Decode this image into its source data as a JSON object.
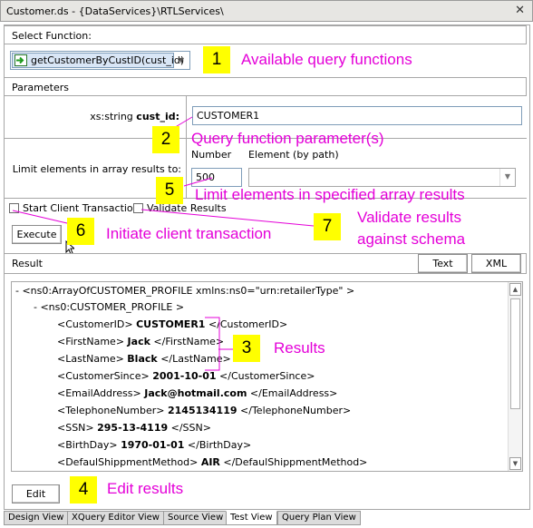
{
  "window": {
    "title": "Customer.ds - {DataServices}\\RTLServices\\"
  },
  "select_function": {
    "header": "Select Function:",
    "selected": "getCustomerByCustID(cust_id)"
  },
  "parameters": {
    "header": "Parameters",
    "param_label_type": "xs:string ",
    "param_label_name": "cust_id:",
    "param_value": "CUSTOMER1",
    "limit_label": "Limit elements in array results to:",
    "number_header": "Number",
    "element_header": "Element (by path)",
    "number_value": "500",
    "element_value": ""
  },
  "options": {
    "start_tx_label": "Start Client Transaction",
    "validate_label": "Validate Results",
    "start_tx_checked": false,
    "validate_checked": false
  },
  "buttons": {
    "execute": "Execute",
    "text": "Text",
    "xml": "XML",
    "edit": "Edit"
  },
  "result": {
    "header": "Result",
    "lines": [
      {
        "pre": "- <ns0:ArrayOfCUSTOMER_PROFILE xmlns:ns0=\"urn:retailerType\" >",
        "val": "",
        "post": ""
      },
      {
        "pre": "- <ns0:CUSTOMER_PROFILE >",
        "val": "",
        "post": ""
      },
      {
        "pre": "<CustomerID> ",
        "val": "CUSTOMER1",
        "post": " </CustomerID>"
      },
      {
        "pre": "<FirstName> ",
        "val": "Jack",
        "post": " </FirstName>"
      },
      {
        "pre": "<LastName> ",
        "val": "Black",
        "post": " </LastName>"
      },
      {
        "pre": "<CustomerSince> ",
        "val": "2001-10-01",
        "post": " </CustomerSince>"
      },
      {
        "pre": "<EmailAddress> ",
        "val": "Jack@hotmail.com",
        "post": " </EmailAddress>"
      },
      {
        "pre": "<TelephoneNumber> ",
        "val": "2145134119",
        "post": " </TelephoneNumber>"
      },
      {
        "pre": "<SSN> ",
        "val": "295-13-4119",
        "post": " </SSN>"
      },
      {
        "pre": "<BirthDay> ",
        "val": "1970-01-01",
        "post": " </BirthDay>"
      },
      {
        "pre": "<DefaulShippmentMethod> ",
        "val": "AIR",
        "post": " </DefaulShippmentMethod>"
      }
    ]
  },
  "tabs": [
    "Design View",
    "XQuery Editor View",
    "Source View",
    "Test View",
    "Query Plan View"
  ],
  "active_tab": "Test View",
  "annotations": {
    "n1": "1",
    "c1": "Available query functions",
    "n2": "2",
    "c2": "Query function parameter(s)",
    "n3": "3",
    "c3": "Results",
    "n4": "4",
    "c4": "Edit results",
    "n5": "5",
    "c5": "Limit elements in specified array results",
    "n6": "6",
    "c6": "Initiate client transaction",
    "n7": "7",
    "c7a": "Validate results",
    "c7b": "against schema"
  },
  "colors": {
    "callout": "#e400d8",
    "badge": "#ffff00"
  }
}
